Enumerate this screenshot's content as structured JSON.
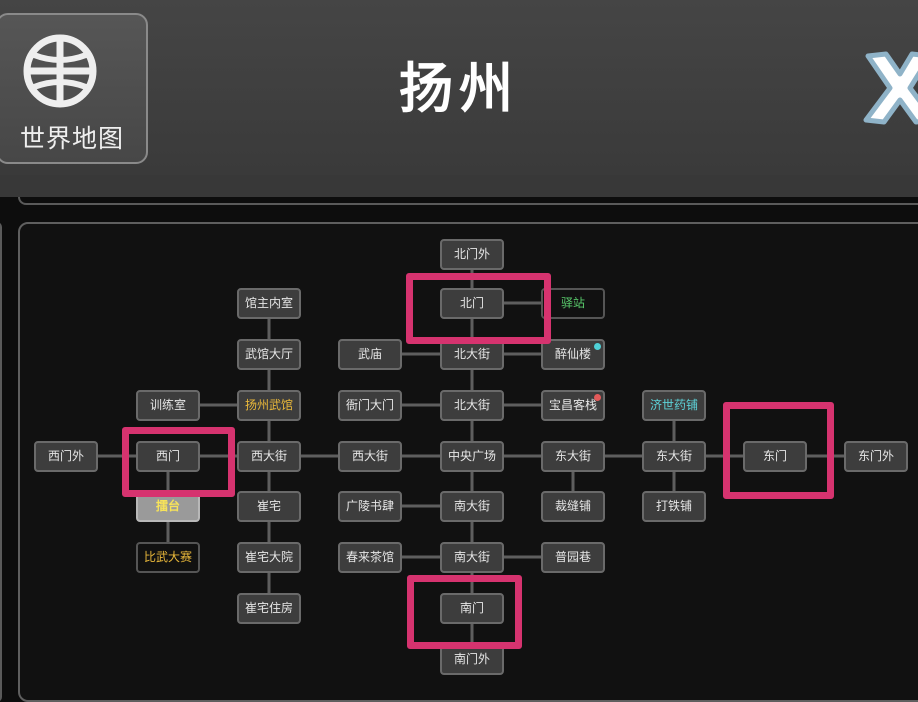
{
  "header": {
    "world_map_label": "世界地图",
    "city_title": "扬州"
  },
  "icons": {
    "globe": "globe-icon",
    "close": "close-icon"
  },
  "colors": {
    "highlight": "#d6336f",
    "green_text": "#58c86a",
    "gold_text": "#e9b83a",
    "cyan_text": "#5dd2d8",
    "stage_text": "#f7e35a"
  },
  "map": {
    "locations": [
      {
        "id": "n0",
        "label": "北门外"
      },
      {
        "id": "n1",
        "label": "北门",
        "highlighted": true
      },
      {
        "id": "n2",
        "label": "驿站",
        "color": "green"
      },
      {
        "id": "n3",
        "label": "馆主内室"
      },
      {
        "id": "n4",
        "label": "武馆大厅"
      },
      {
        "id": "n5",
        "label": "武庙"
      },
      {
        "id": "n6",
        "label": "北大街"
      },
      {
        "id": "n7",
        "label": "醉仙楼",
        "dot": "cyan"
      },
      {
        "id": "n8",
        "label": "训练室"
      },
      {
        "id": "n9",
        "label": "扬州武馆",
        "color": "gold"
      },
      {
        "id": "n10",
        "label": "衙门大门"
      },
      {
        "id": "n11",
        "label": "北大街"
      },
      {
        "id": "n12",
        "label": "宝昌客栈",
        "dot": "red"
      },
      {
        "id": "n13",
        "label": "济世药铺",
        "color": "cyan"
      },
      {
        "id": "n14",
        "label": "西门外"
      },
      {
        "id": "n15",
        "label": "西门",
        "highlighted": true
      },
      {
        "id": "n16",
        "label": "西大街"
      },
      {
        "id": "n17",
        "label": "西大街"
      },
      {
        "id": "n18",
        "label": "中央广场"
      },
      {
        "id": "n19",
        "label": "东大街"
      },
      {
        "id": "n20",
        "label": "东大街"
      },
      {
        "id": "n21",
        "label": "东门",
        "highlighted": true
      },
      {
        "id": "n22",
        "label": "东门外"
      },
      {
        "id": "n23",
        "label": "擂台",
        "color": "stage"
      },
      {
        "id": "n24",
        "label": "崔宅"
      },
      {
        "id": "n25",
        "label": "广陵书肆"
      },
      {
        "id": "n26",
        "label": "南大街"
      },
      {
        "id": "n27",
        "label": "裁缝铺"
      },
      {
        "id": "n28",
        "label": "打铁铺"
      },
      {
        "id": "n29",
        "label": "比武大赛",
        "color": "gold"
      },
      {
        "id": "n30",
        "label": "崔宅大院"
      },
      {
        "id": "n31",
        "label": "春来茶馆"
      },
      {
        "id": "n32",
        "label": "南大街"
      },
      {
        "id": "n33",
        "label": "普园巷"
      },
      {
        "id": "n34",
        "label": "崔宅住房"
      },
      {
        "id": "n35",
        "label": "南门",
        "highlighted": true
      },
      {
        "id": "n36",
        "label": "南门外"
      }
    ]
  }
}
